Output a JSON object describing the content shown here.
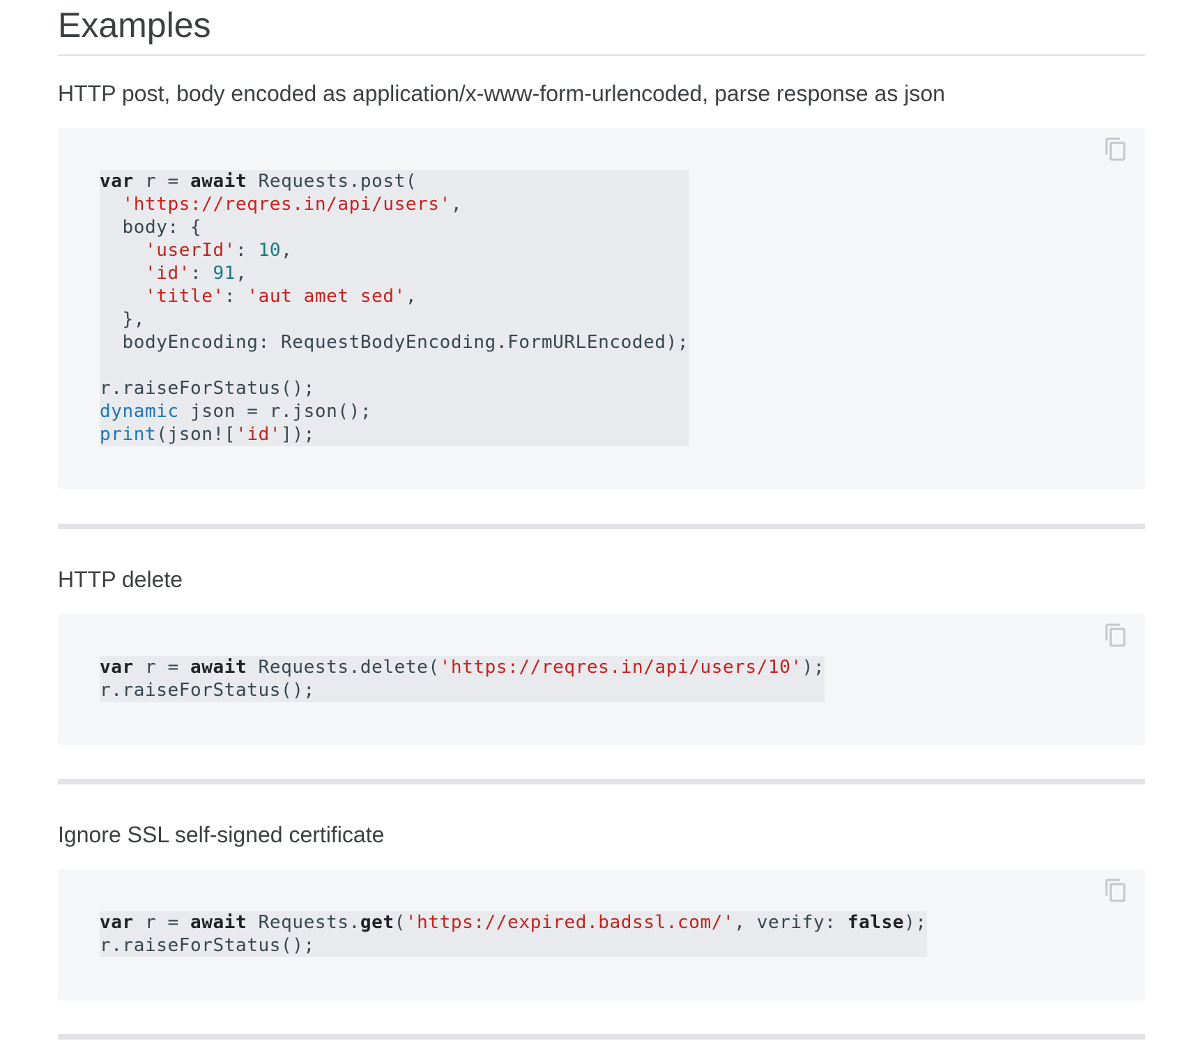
{
  "heading": "Examples",
  "examples": [
    {
      "title": "HTTP post, body encoded as application/x-www-form-urlencoded, parse response as json",
      "copy_icon": "copy-icon",
      "code_lines": [
        [
          {
            "t": "var",
            "c": "kw"
          },
          {
            "t": " r = "
          },
          {
            "t": "await",
            "c": "kw"
          },
          {
            "t": " Requests.post("
          }
        ],
        [
          {
            "t": "  "
          },
          {
            "t": "'https://reqres.in/api/users'",
            "c": "str"
          },
          {
            "t": ","
          }
        ],
        [
          {
            "t": "  body: {"
          }
        ],
        [
          {
            "t": "    "
          },
          {
            "t": "'userId'",
            "c": "str"
          },
          {
            "t": ": "
          },
          {
            "t": "10",
            "c": "num"
          },
          {
            "t": ","
          }
        ],
        [
          {
            "t": "    "
          },
          {
            "t": "'id'",
            "c": "str"
          },
          {
            "t": ": "
          },
          {
            "t": "91",
            "c": "num"
          },
          {
            "t": ","
          }
        ],
        [
          {
            "t": "    "
          },
          {
            "t": "'title'",
            "c": "str"
          },
          {
            "t": ": "
          },
          {
            "t": "'aut amet sed'",
            "c": "str"
          },
          {
            "t": ","
          }
        ],
        [
          {
            "t": "  },"
          }
        ],
        [
          {
            "t": "  bodyEncoding: RequestBodyEncoding.FormURLEncoded);"
          }
        ],
        [],
        [
          {
            "t": "r.raiseForStatus();"
          }
        ],
        [
          {
            "t": "dynamic",
            "c": "typ"
          },
          {
            "t": " json = r.json();"
          }
        ],
        [
          {
            "t": "print",
            "c": "typ"
          },
          {
            "t": "(json!["
          },
          {
            "t": "'id'",
            "c": "str"
          },
          {
            "t": "]);"
          }
        ]
      ]
    },
    {
      "title": "HTTP delete",
      "copy_icon": "copy-icon",
      "code_lines": [
        [
          {
            "t": "var",
            "c": "kw"
          },
          {
            "t": " r = "
          },
          {
            "t": "await",
            "c": "kw"
          },
          {
            "t": " Requests.delete("
          },
          {
            "t": "'https://reqres.in/api/users/10'",
            "c": "str"
          },
          {
            "t": ");"
          }
        ],
        [
          {
            "t": "r.raiseForStatus();"
          }
        ]
      ]
    },
    {
      "title": "Ignore SSL self-signed certificate",
      "copy_icon": "copy-icon",
      "code_lines": [
        [
          {
            "t": "var",
            "c": "kw"
          },
          {
            "t": " r = "
          },
          {
            "t": "await",
            "c": "kw"
          },
          {
            "t": " Requests."
          },
          {
            "t": "get",
            "c": "kw"
          },
          {
            "t": "("
          },
          {
            "t": "'https://expired.badssl.com/'",
            "c": "str"
          },
          {
            "t": ", verify: "
          },
          {
            "t": "false",
            "c": "kw"
          },
          {
            "t": ");"
          }
        ],
        [
          {
            "t": "r.raiseForStatus();"
          }
        ]
      ]
    }
  ]
}
